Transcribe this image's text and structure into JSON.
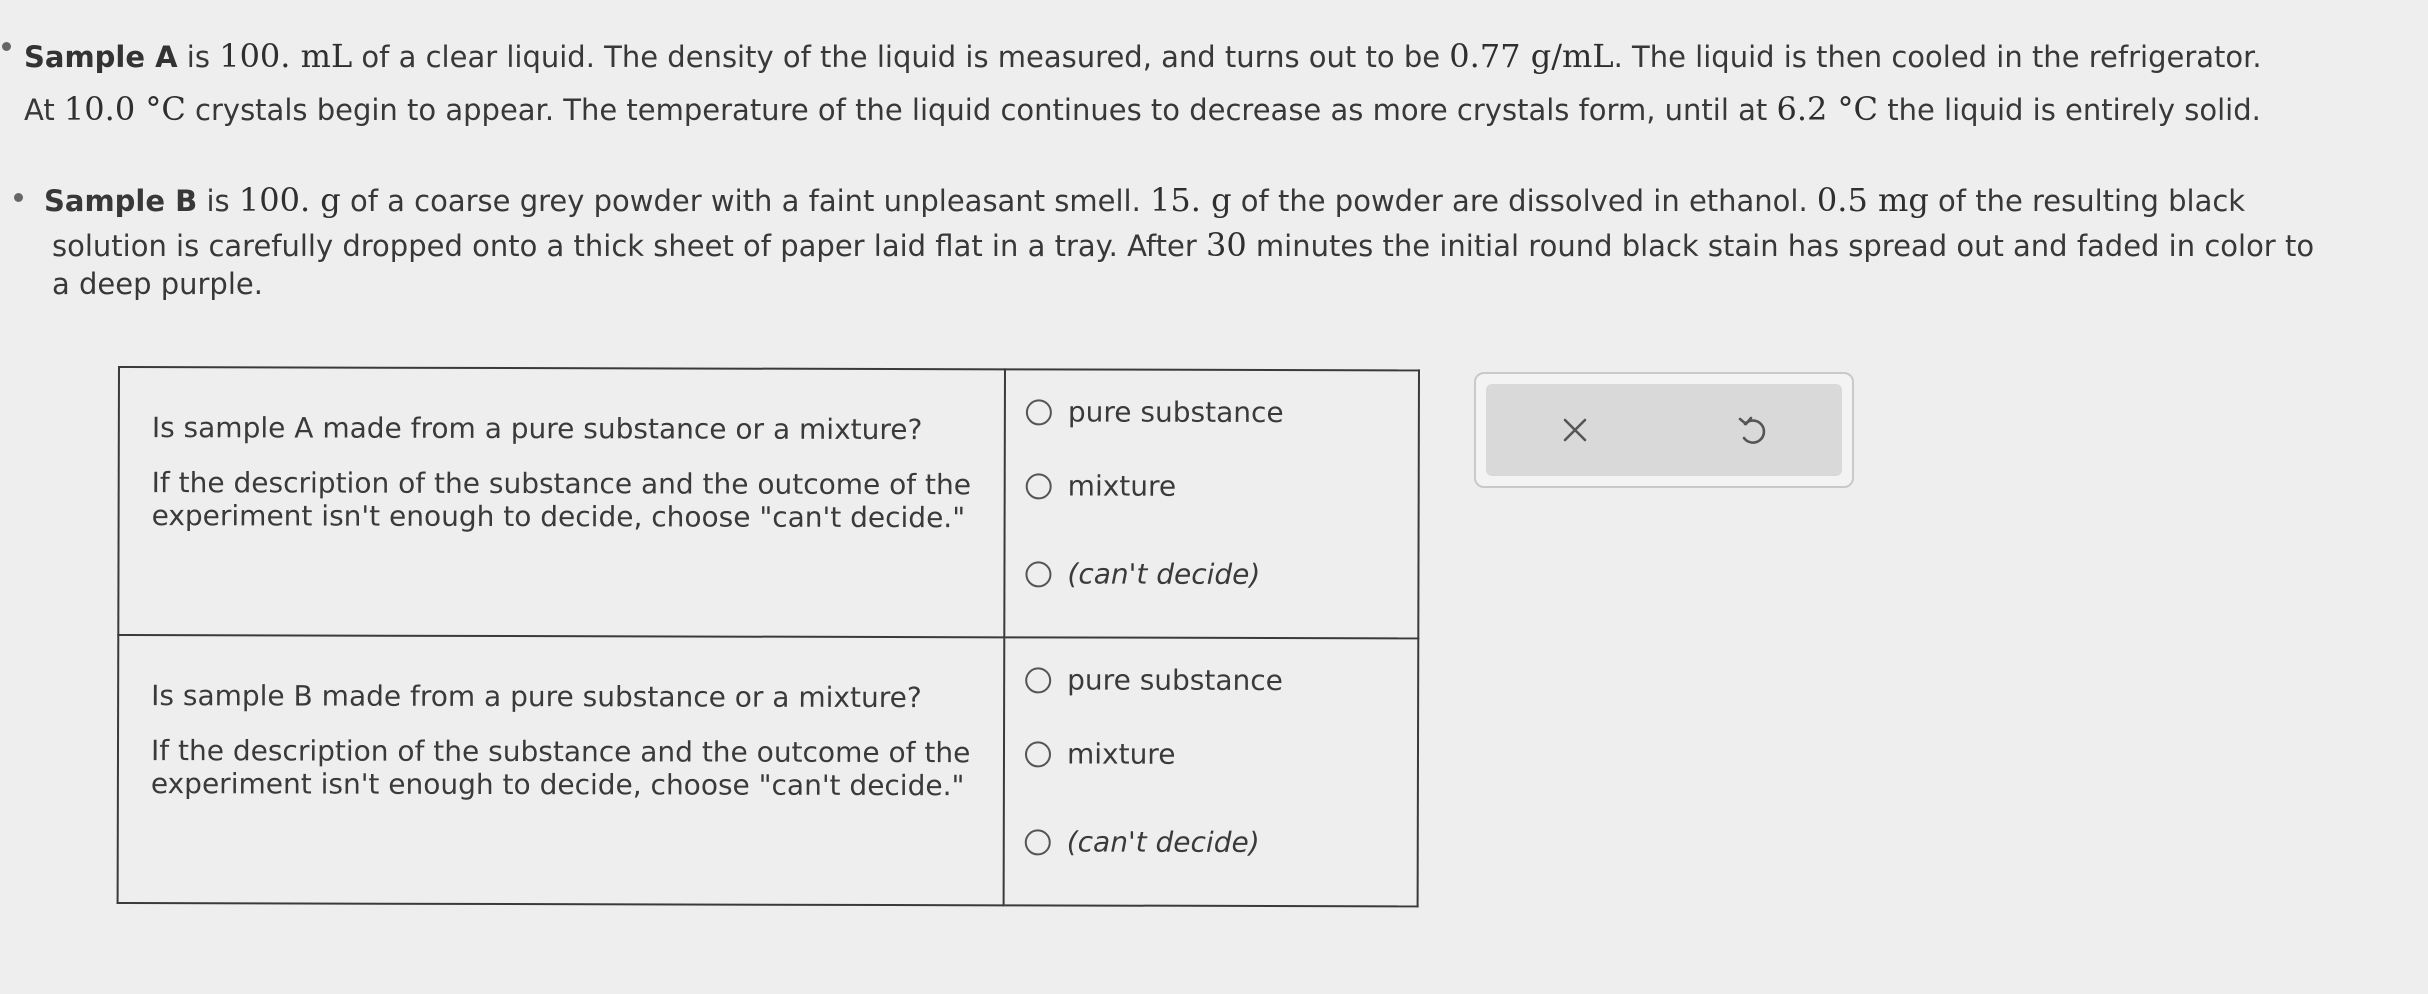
{
  "sampleA": {
    "bold": "Sample A",
    "t1": " is ",
    "v1": "100. mL",
    "t2": " of a clear liquid. The density of the liquid is measured, and turns out to be ",
    "v2": "0.77 g/mL",
    "t3": ". The liquid is then cooled in the refrigerator.",
    "t4": "At ",
    "v3": "10.0 °C",
    "t5": " crystals begin to appear. The temperature of the liquid continues to decrease as more crystals form, until at ",
    "v4": "6.2 °C",
    "t6": " the liquid is entirely solid."
  },
  "sampleB": {
    "bold": "Sample B",
    "t1": " is ",
    "v1": "100. g",
    "t2": " of a coarse grey powder with a faint unpleasant smell. ",
    "v2": "15. g",
    "t3": " of the powder are dissolved in ethanol. ",
    "v3": "0.5 mg",
    "t4": " of the resulting black",
    "t5": "solution is carefully dropped onto a thick sheet of paper laid flat in a tray. After ",
    "v4": "30",
    "t6": " minutes the initial round black stain has spread out and faded in color to",
    "t7": "a deep purple."
  },
  "questions": [
    {
      "prompt": "Is sample A made from a pure substance or a mixture?",
      "note": "If the description of the substance and the outcome of the experiment isn't enough to decide, choose \"can't decide.\"",
      "options": [
        "pure substance",
        "mixture",
        "(can't decide)"
      ]
    },
    {
      "prompt": "Is sample B made from a pure substance or a mixture?",
      "note": "If the description of the substance and the outcome of the experiment isn't enough to decide, choose \"can't decide.\"",
      "options": [
        "pure substance",
        "mixture",
        "(can't decide)"
      ]
    }
  ],
  "toolbar": {
    "clear_icon": "close-icon",
    "undo_icon": "undo-icon"
  }
}
